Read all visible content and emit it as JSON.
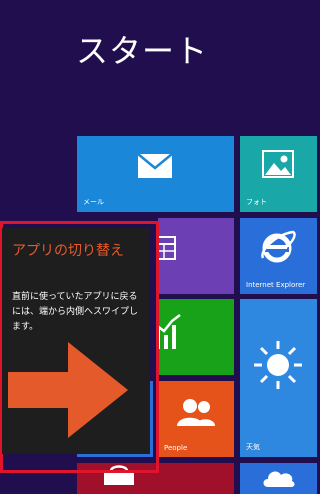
{
  "screen": {
    "title": "スタート"
  },
  "tiles": {
    "mail": {
      "label": "メール"
    },
    "photos": {
      "label": "フォト"
    },
    "ie": {
      "label": "Internet Explorer"
    },
    "people": {
      "label": "People"
    },
    "weather": {
      "label": "天気"
    }
  },
  "tip": {
    "title": "アプリの切り替え",
    "body": "直前に使っていたアプリに戻るには、端から内側へスワイプします。"
  },
  "colors": {
    "background": "#200e4f",
    "tip_accent": "#e55a2b",
    "highlight_frame": "#e0142a"
  }
}
